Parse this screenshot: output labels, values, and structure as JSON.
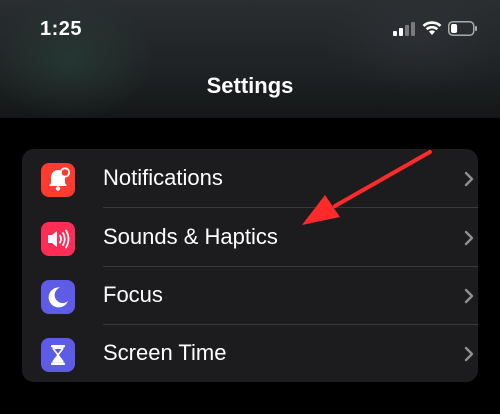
{
  "status_bar": {
    "time": "1:25",
    "signal_icon": "cellular-signal-icon",
    "wifi_icon": "wifi-icon",
    "battery_icon": "battery-icon",
    "battery_level": 0.3
  },
  "header": {
    "title": "Settings"
  },
  "settings_group": {
    "items": [
      {
        "label": "Notifications",
        "icon": "notification-bell-icon",
        "icon_color": "#ff3b30"
      },
      {
        "label": "Sounds & Haptics",
        "icon": "speaker-icon",
        "icon_color": "#ff2d55"
      },
      {
        "label": "Focus",
        "icon": "moon-icon",
        "icon_color": "#5e5ce6"
      },
      {
        "label": "Screen Time",
        "icon": "hourglass-icon",
        "icon_color": "#5e5ce6"
      }
    ]
  },
  "annotation": {
    "arrow_color": "#ff2a2a",
    "arrow_icon": "red-arrow-annotation"
  },
  "colors": {
    "background": "#000000",
    "group_background": "#1c1c1e",
    "chevron": "#8e8e93",
    "divider": "#38383a"
  }
}
